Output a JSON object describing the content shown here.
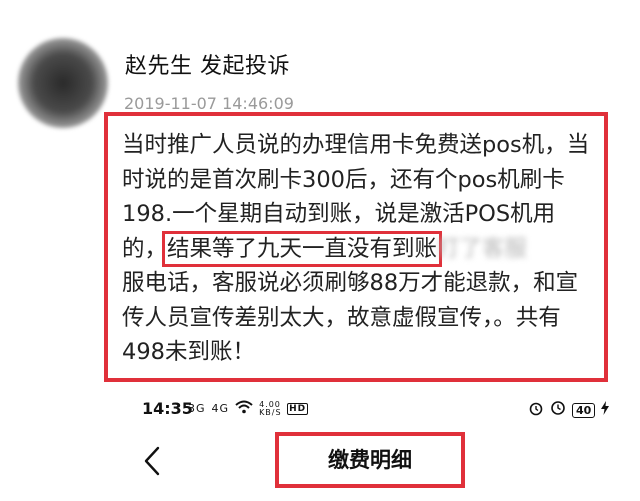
{
  "post": {
    "username": "赵先生 发起投诉",
    "timestamp": "2019-11-07 14:46:09",
    "lines": [
      "当时推广人员说的办理信用卡免费送pos机，当",
      "时说的是首次刷卡300后，还有个pos机刷卡",
      "198.一个星期自动到账，说是激活POS机用",
      "服电话，客服说必须刷够88万才能退款，和宣",
      "传人员宣传差别太大，故意虚假宣传，。共有",
      "498未到账！"
    ],
    "line4_prefix": "的，",
    "line4_highlight": "结果等了九天一直没有到账",
    "line4_blurred": "打了客服"
  },
  "status_bar": {
    "time": "14:35",
    "signal_1": "3G",
    "signal_2": "4G",
    "network_speed": "4.00 KB/S",
    "hd": "HD",
    "battery": "40"
  },
  "nav": {
    "title": "缴费明细"
  },
  "colors": {
    "annotation_red": "#e0303a",
    "timestamp_gray": "#9a9a9a"
  },
  "icons": {
    "back": "chevron-left-icon",
    "wifi": "wifi-icon",
    "alarm": "alarm-icon",
    "battery": "battery-icon",
    "charging": "lightning-icon"
  }
}
